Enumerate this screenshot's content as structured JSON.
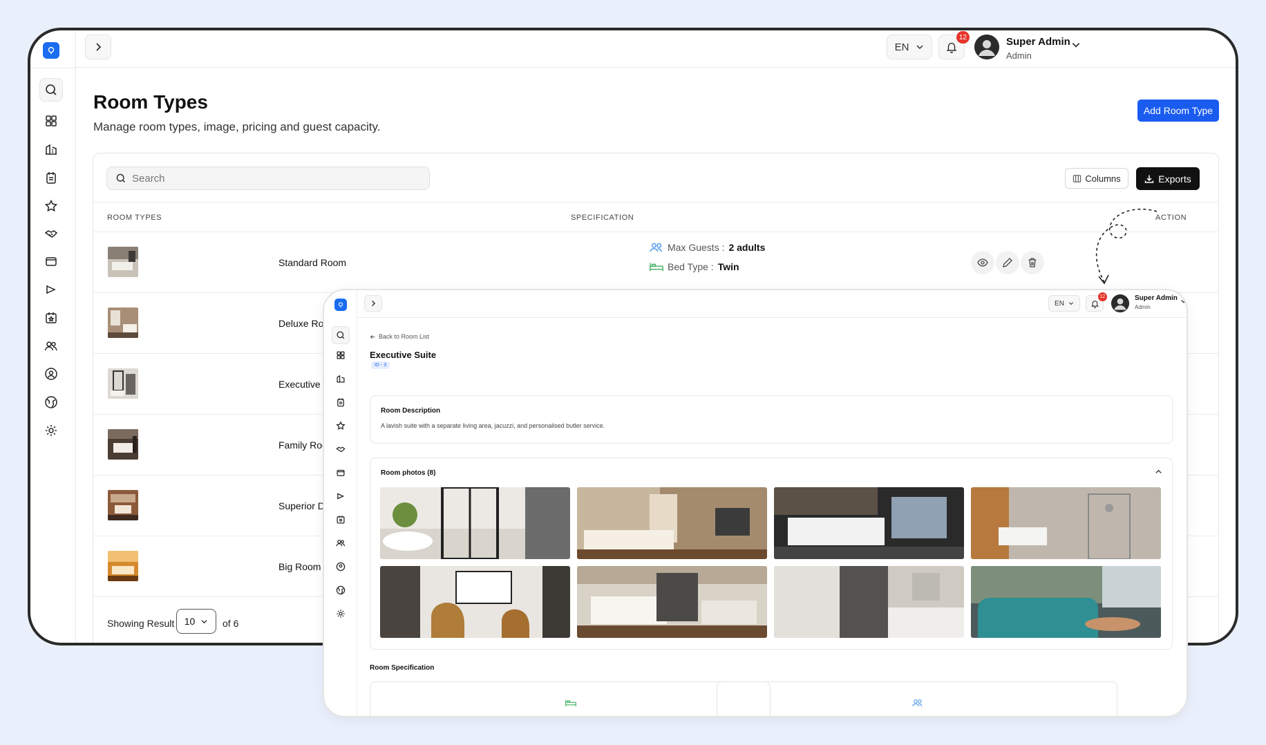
{
  "app": {
    "lang": "EN",
    "notification_count": "12",
    "user_name": "Super Admin",
    "user_role": "Admin",
    "accent_color": "#1a5cf0"
  },
  "sidebar": {
    "icons": [
      "search-icon",
      "dashboard-icon",
      "building-icon",
      "clipboard-icon",
      "star-icon",
      "handshake-icon",
      "wallet-icon",
      "megaphone-icon",
      "calendar-star-icon",
      "users-icon",
      "user-circle-icon",
      "globe-icon",
      "settings-icon"
    ]
  },
  "page": {
    "title": "Room Types",
    "subtitle": "Manage room types, image, pricing and guest capacity.",
    "add_button": "Add Room Type"
  },
  "toolbar": {
    "search_placeholder": "Search",
    "columns_label": "Columns",
    "exports_label": "Exports"
  },
  "table": {
    "headers": {
      "room_types": "ROOM TYPES",
      "specification": "SPECIFICATION",
      "action": "ACTION"
    },
    "rows": [
      {
        "name": "Standard Room",
        "max_guests_label": "Max Guests :",
        "max_guests": "2 adults",
        "bed_type_label": "Bed Type :",
        "bed_type": "Twin"
      },
      {
        "name": "Deluxe Room"
      },
      {
        "name": "Executive Suite"
      },
      {
        "name": "Family Room"
      },
      {
        "name": "Superior Deluxe"
      },
      {
        "name": "Big Room"
      }
    ]
  },
  "pagination": {
    "showing_label": "Showing Result",
    "page_size": "10",
    "of_label": "of 6"
  },
  "detail": {
    "back_label": "Back to Room List",
    "title": "Executive Suite",
    "id_badge": "ID - 3",
    "description_heading": "Room Description",
    "description_text": "A lavish suite with a separate living area, jacuzzi, and personalised butler service.",
    "photos_heading": "Room photos (8)",
    "spec_heading": "Room Specification"
  }
}
